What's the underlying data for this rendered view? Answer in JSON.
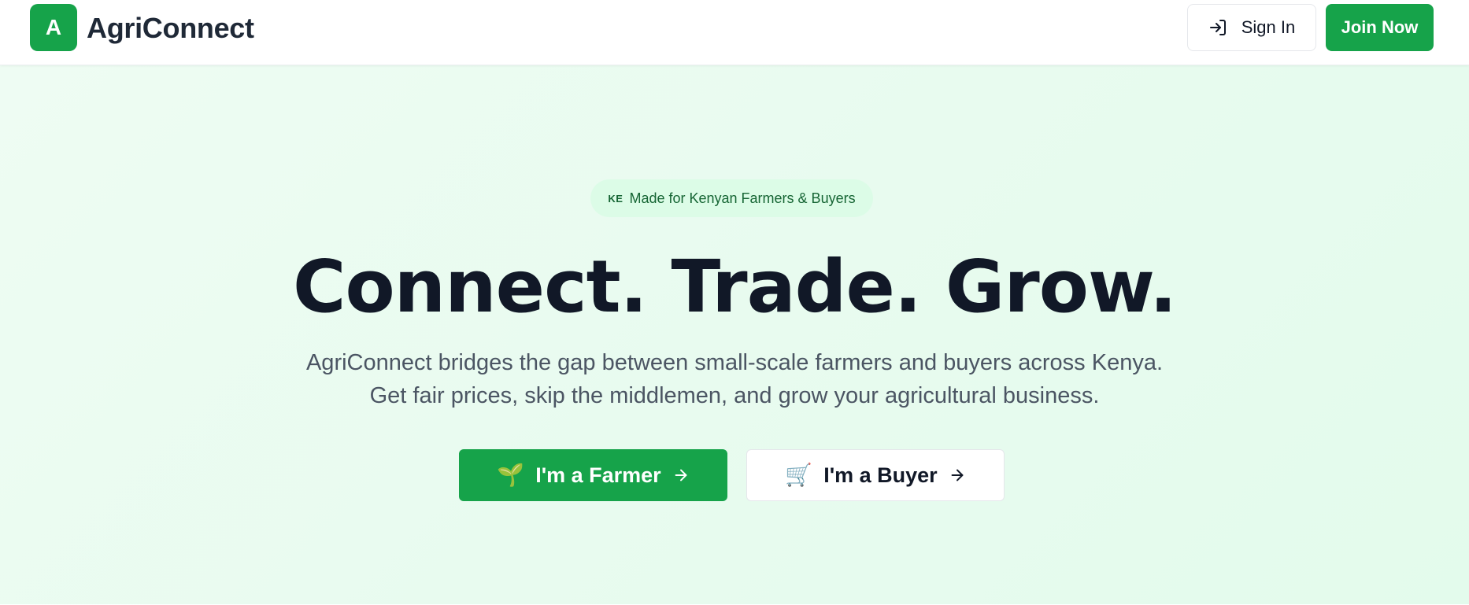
{
  "header": {
    "logo_letter": "A",
    "brand_name": "AgriConnect",
    "signin_label": "Sign In",
    "signin_icon": "sign-in-icon",
    "join_label": "Join Now"
  },
  "hero": {
    "badge_flag": "KE",
    "badge_text": "Made for Kenyan Farmers & Buyers",
    "headline": "Connect. Trade. Grow.",
    "subtext_line1": "AgriConnect bridges the gap between small-scale farmers and buyers across Kenya.",
    "subtext_line2": "Get fair prices, skip the middlemen, and grow your agricultural business.",
    "farmer_button": {
      "icon": "🌱",
      "icon_name": "seedling-icon",
      "label": "I'm a Farmer",
      "arrow": "arrow-right-icon"
    },
    "buyer_button": {
      "icon": "🛒",
      "icon_name": "cart-icon",
      "label": "I'm a Buyer",
      "arrow": "arrow-right-icon"
    }
  },
  "colors": {
    "brand_green": "#16a34a",
    "badge_bg": "#dcfce7",
    "badge_text": "#166534",
    "headline": "#111827",
    "subtext": "#4b5563"
  }
}
